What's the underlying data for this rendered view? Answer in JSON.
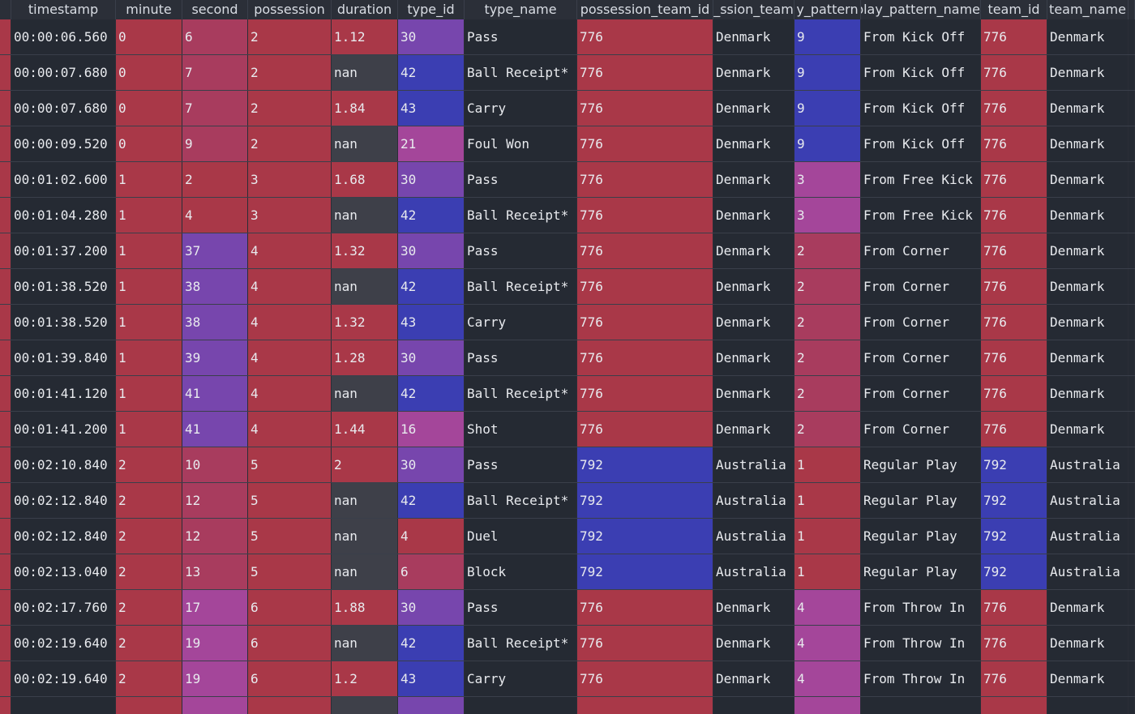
{
  "colors": {
    "red": "#a93848",
    "rose": "#a83c5e",
    "magenta": "#a4469a",
    "violet": "#7746ad",
    "blue": "#3b3eb2",
    "gray": "#3e4049",
    "dark": "#252a33",
    "index": "#a93848"
  },
  "columns": [
    {
      "key": "timestamp",
      "label": "timestamp"
    },
    {
      "key": "minute",
      "label": "minute"
    },
    {
      "key": "second",
      "label": "second"
    },
    {
      "key": "possession",
      "label": "possession"
    },
    {
      "key": "duration",
      "label": "duration"
    },
    {
      "key": "type_id",
      "label": "type_id"
    },
    {
      "key": "type_name",
      "label": "type_name"
    },
    {
      "key": "possession_team_id",
      "label": "possession_team_id"
    },
    {
      "key": "possession_team_name",
      "label": "ssion_team_"
    },
    {
      "key": "play_pattern_id",
      "label": "y_pattern"
    },
    {
      "key": "play_pattern_name",
      "label": "play_pattern_name"
    },
    {
      "key": "team_id",
      "label": "team_id"
    },
    {
      "key": "team_name",
      "label": "team_name"
    },
    {
      "key": "overflow",
      "label": ""
    }
  ],
  "rows": [
    {
      "timestamp": "00:00:06.560",
      "minute": "0",
      "second": "6",
      "possession": "2",
      "duration": "1.12",
      "type_id": "30",
      "type_name": "Pass",
      "possession_team_id": "776",
      "possession_team_name": "Denmark",
      "play_pattern_id": "9",
      "play_pattern_name": "From Kick Off",
      "team_id": "776",
      "team_name": "Denmark",
      "bg": {
        "minute": "red",
        "second": "rose",
        "possession": "red",
        "duration": "red",
        "type_id": "violet",
        "possession_team_id": "red",
        "play_pattern_id": "blue",
        "team_id": "red"
      }
    },
    {
      "timestamp": "00:00:07.680",
      "minute": "0",
      "second": "7",
      "possession": "2",
      "duration": "nan",
      "type_id": "42",
      "type_name": "Ball Receipt*",
      "possession_team_id": "776",
      "possession_team_name": "Denmark",
      "play_pattern_id": "9",
      "play_pattern_name": "From Kick Off",
      "team_id": "776",
      "team_name": "Denmark",
      "bg": {
        "minute": "red",
        "second": "rose",
        "possession": "red",
        "duration": "gray",
        "type_id": "blue",
        "possession_team_id": "red",
        "play_pattern_id": "blue",
        "team_id": "red"
      }
    },
    {
      "timestamp": "00:00:07.680",
      "minute": "0",
      "second": "7",
      "possession": "2",
      "duration": "1.84",
      "type_id": "43",
      "type_name": "Carry",
      "possession_team_id": "776",
      "possession_team_name": "Denmark",
      "play_pattern_id": "9",
      "play_pattern_name": "From Kick Off",
      "team_id": "776",
      "team_name": "Denmark",
      "bg": {
        "minute": "red",
        "second": "rose",
        "possession": "red",
        "duration": "red",
        "type_id": "blue",
        "possession_team_id": "red",
        "play_pattern_id": "blue",
        "team_id": "red"
      }
    },
    {
      "timestamp": "00:00:09.520",
      "minute": "0",
      "second": "9",
      "possession": "2",
      "duration": "nan",
      "type_id": "21",
      "type_name": "Foul Won",
      "possession_team_id": "776",
      "possession_team_name": "Denmark",
      "play_pattern_id": "9",
      "play_pattern_name": "From Kick Off",
      "team_id": "776",
      "team_name": "Denmark",
      "bg": {
        "minute": "red",
        "second": "rose",
        "possession": "red",
        "duration": "gray",
        "type_id": "magenta",
        "possession_team_id": "red",
        "play_pattern_id": "blue",
        "team_id": "red"
      }
    },
    {
      "timestamp": "00:01:02.600",
      "minute": "1",
      "second": "2",
      "possession": "3",
      "duration": "1.68",
      "type_id": "30",
      "type_name": "Pass",
      "possession_team_id": "776",
      "possession_team_name": "Denmark",
      "play_pattern_id": "3",
      "play_pattern_name": "From Free Kick",
      "team_id": "776",
      "team_name": "Denmark",
      "bg": {
        "minute": "red",
        "second": "red",
        "possession": "red",
        "duration": "red",
        "type_id": "violet",
        "possession_team_id": "red",
        "play_pattern_id": "magenta",
        "team_id": "red"
      }
    },
    {
      "timestamp": "00:01:04.280",
      "minute": "1",
      "second": "4",
      "possession": "3",
      "duration": "nan",
      "type_id": "42",
      "type_name": "Ball Receipt*",
      "possession_team_id": "776",
      "possession_team_name": "Denmark",
      "play_pattern_id": "3",
      "play_pattern_name": "From Free Kick",
      "team_id": "776",
      "team_name": "Denmark",
      "bg": {
        "minute": "red",
        "second": "red",
        "possession": "red",
        "duration": "gray",
        "type_id": "blue",
        "possession_team_id": "red",
        "play_pattern_id": "magenta",
        "team_id": "red"
      }
    },
    {
      "timestamp": "00:01:37.200",
      "minute": "1",
      "second": "37",
      "possession": "4",
      "duration": "1.32",
      "type_id": "30",
      "type_name": "Pass",
      "possession_team_id": "776",
      "possession_team_name": "Denmark",
      "play_pattern_id": "2",
      "play_pattern_name": "From Corner",
      "team_id": "776",
      "team_name": "Denmark",
      "bg": {
        "minute": "red",
        "second": "violet",
        "possession": "red",
        "duration": "red",
        "type_id": "violet",
        "possession_team_id": "red",
        "play_pattern_id": "rose",
        "team_id": "red"
      }
    },
    {
      "timestamp": "00:01:38.520",
      "minute": "1",
      "second": "38",
      "possession": "4",
      "duration": "nan",
      "type_id": "42",
      "type_name": "Ball Receipt*",
      "possession_team_id": "776",
      "possession_team_name": "Denmark",
      "play_pattern_id": "2",
      "play_pattern_name": "From Corner",
      "team_id": "776",
      "team_name": "Denmark",
      "bg": {
        "minute": "red",
        "second": "violet",
        "possession": "red",
        "duration": "gray",
        "type_id": "blue",
        "possession_team_id": "red",
        "play_pattern_id": "rose",
        "team_id": "red"
      }
    },
    {
      "timestamp": "00:01:38.520",
      "minute": "1",
      "second": "38",
      "possession": "4",
      "duration": "1.32",
      "type_id": "43",
      "type_name": "Carry",
      "possession_team_id": "776",
      "possession_team_name": "Denmark",
      "play_pattern_id": "2",
      "play_pattern_name": "From Corner",
      "team_id": "776",
      "team_name": "Denmark",
      "bg": {
        "minute": "red",
        "second": "violet",
        "possession": "red",
        "duration": "red",
        "type_id": "blue",
        "possession_team_id": "red",
        "play_pattern_id": "rose",
        "team_id": "red"
      }
    },
    {
      "timestamp": "00:01:39.840",
      "minute": "1",
      "second": "39",
      "possession": "4",
      "duration": "1.28",
      "type_id": "30",
      "type_name": "Pass",
      "possession_team_id": "776",
      "possession_team_name": "Denmark",
      "play_pattern_id": "2",
      "play_pattern_name": "From Corner",
      "team_id": "776",
      "team_name": "Denmark",
      "bg": {
        "minute": "red",
        "second": "violet",
        "possession": "red",
        "duration": "red",
        "type_id": "violet",
        "possession_team_id": "red",
        "play_pattern_id": "rose",
        "team_id": "red"
      }
    },
    {
      "timestamp": "00:01:41.120",
      "minute": "1",
      "second": "41",
      "possession": "4",
      "duration": "nan",
      "type_id": "42",
      "type_name": "Ball Receipt*",
      "possession_team_id": "776",
      "possession_team_name": "Denmark",
      "play_pattern_id": "2",
      "play_pattern_name": "From Corner",
      "team_id": "776",
      "team_name": "Denmark",
      "bg": {
        "minute": "red",
        "second": "violet",
        "possession": "red",
        "duration": "gray",
        "type_id": "blue",
        "possession_team_id": "red",
        "play_pattern_id": "rose",
        "team_id": "red"
      }
    },
    {
      "timestamp": "00:01:41.200",
      "minute": "1",
      "second": "41",
      "possession": "4",
      "duration": "1.44",
      "type_id": "16",
      "type_name": "Shot",
      "possession_team_id": "776",
      "possession_team_name": "Denmark",
      "play_pattern_id": "2",
      "play_pattern_name": "From Corner",
      "team_id": "776",
      "team_name": "Denmark",
      "bg": {
        "minute": "red",
        "second": "violet",
        "possession": "red",
        "duration": "red",
        "type_id": "magenta",
        "possession_team_id": "red",
        "play_pattern_id": "rose",
        "team_id": "red"
      }
    },
    {
      "timestamp": "00:02:10.840",
      "minute": "2",
      "second": "10",
      "possession": "5",
      "duration": "2",
      "type_id": "30",
      "type_name": "Pass",
      "possession_team_id": "792",
      "possession_team_name": "Australia",
      "play_pattern_id": "1",
      "play_pattern_name": "Regular Play",
      "team_id": "792",
      "team_name": "Australia",
      "bg": {
        "minute": "red",
        "second": "rose",
        "possession": "red",
        "duration": "red",
        "type_id": "violet",
        "possession_team_id": "blue",
        "play_pattern_id": "red",
        "team_id": "blue"
      }
    },
    {
      "timestamp": "00:02:12.840",
      "minute": "2",
      "second": "12",
      "possession": "5",
      "duration": "nan",
      "type_id": "42",
      "type_name": "Ball Receipt*",
      "possession_team_id": "792",
      "possession_team_name": "Australia",
      "play_pattern_id": "1",
      "play_pattern_name": "Regular Play",
      "team_id": "792",
      "team_name": "Australia",
      "bg": {
        "minute": "red",
        "second": "rose",
        "possession": "red",
        "duration": "gray",
        "type_id": "blue",
        "possession_team_id": "blue",
        "play_pattern_id": "red",
        "team_id": "blue"
      }
    },
    {
      "timestamp": "00:02:12.840",
      "minute": "2",
      "second": "12",
      "possession": "5",
      "duration": "nan",
      "type_id": "4",
      "type_name": "Duel",
      "possession_team_id": "792",
      "possession_team_name": "Australia",
      "play_pattern_id": "1",
      "play_pattern_name": "Regular Play",
      "team_id": "792",
      "team_name": "Australia",
      "bg": {
        "minute": "red",
        "second": "rose",
        "possession": "red",
        "duration": "gray",
        "type_id": "red",
        "possession_team_id": "blue",
        "play_pattern_id": "red",
        "team_id": "blue"
      }
    },
    {
      "timestamp": "00:02:13.040",
      "minute": "2",
      "second": "13",
      "possession": "5",
      "duration": "nan",
      "type_id": "6",
      "type_name": "Block",
      "possession_team_id": "792",
      "possession_team_name": "Australia",
      "play_pattern_id": "1",
      "play_pattern_name": "Regular Play",
      "team_id": "792",
      "team_name": "Australia",
      "bg": {
        "minute": "red",
        "second": "rose",
        "possession": "red",
        "duration": "gray",
        "type_id": "rose",
        "possession_team_id": "blue",
        "play_pattern_id": "red",
        "team_id": "blue"
      }
    },
    {
      "timestamp": "00:02:17.760",
      "minute": "2",
      "second": "17",
      "possession": "6",
      "duration": "1.88",
      "type_id": "30",
      "type_name": "Pass",
      "possession_team_id": "776",
      "possession_team_name": "Denmark",
      "play_pattern_id": "4",
      "play_pattern_name": "From Throw In",
      "team_id": "776",
      "team_name": "Denmark",
      "bg": {
        "minute": "red",
        "second": "magenta",
        "possession": "red",
        "duration": "red",
        "type_id": "violet",
        "possession_team_id": "red",
        "play_pattern_id": "magenta",
        "team_id": "red"
      }
    },
    {
      "timestamp": "00:02:19.640",
      "minute": "2",
      "second": "19",
      "possession": "6",
      "duration": "nan",
      "type_id": "42",
      "type_name": "Ball Receipt*",
      "possession_team_id": "776",
      "possession_team_name": "Denmark",
      "play_pattern_id": "4",
      "play_pattern_name": "From Throw In",
      "team_id": "776",
      "team_name": "Denmark",
      "bg": {
        "minute": "red",
        "second": "magenta",
        "possession": "red",
        "duration": "gray",
        "type_id": "blue",
        "possession_team_id": "red",
        "play_pattern_id": "magenta",
        "team_id": "red"
      }
    },
    {
      "timestamp": "00:02:19.640",
      "minute": "2",
      "second": "19",
      "possession": "6",
      "duration": "1.2",
      "type_id": "43",
      "type_name": "Carry",
      "possession_team_id": "776",
      "possession_team_name": "Denmark",
      "play_pattern_id": "4",
      "play_pattern_name": "From Throw In",
      "team_id": "776",
      "team_name": "Denmark",
      "bg": {
        "minute": "red",
        "second": "magenta",
        "possession": "red",
        "duration": "red",
        "type_id": "blue",
        "possession_team_id": "red",
        "play_pattern_id": "magenta",
        "team_id": "red"
      }
    }
  ]
}
